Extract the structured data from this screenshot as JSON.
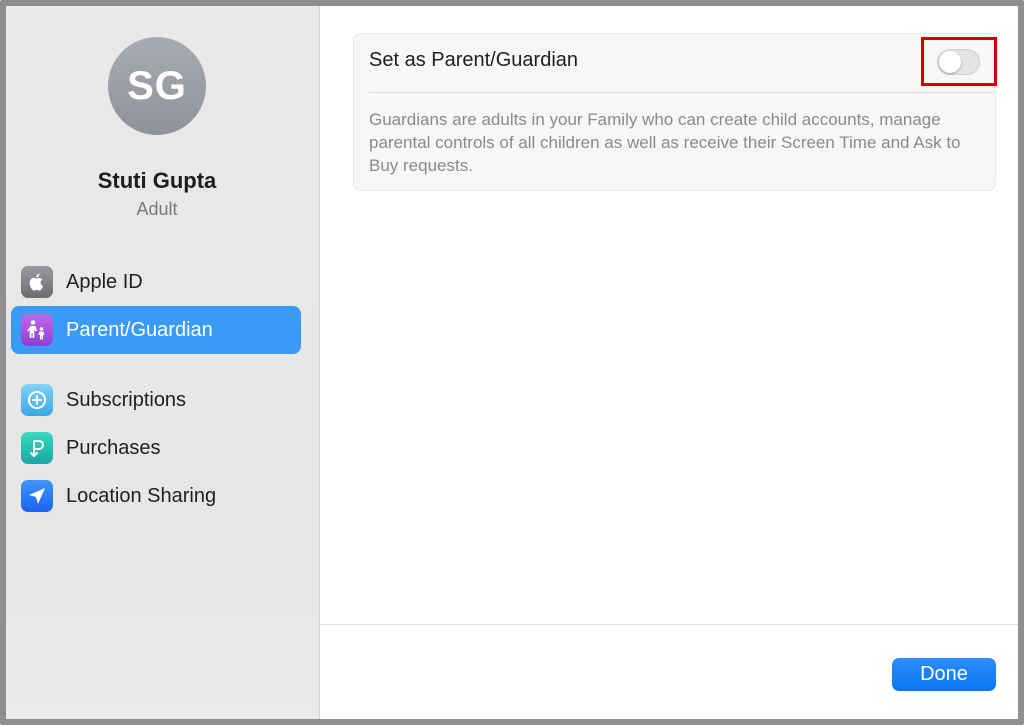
{
  "sidebar": {
    "avatar_initials": "SG",
    "user_name": "Stuti Gupta",
    "user_role": "Adult",
    "items": [
      {
        "label": "Apple ID",
        "icon": "apple-icon",
        "selected": false
      },
      {
        "label": "Parent/Guardian",
        "icon": "guardian-icon",
        "selected": true
      },
      {
        "label": "Subscriptions",
        "icon": "subscriptions-icon",
        "selected": false
      },
      {
        "label": "Purchases",
        "icon": "purchases-icon",
        "selected": false
      },
      {
        "label": "Location Sharing",
        "icon": "location-arrow-icon",
        "selected": false
      }
    ]
  },
  "main": {
    "setting_title": "Set as Parent/Guardian",
    "toggle_on": false,
    "description": "Guardians are adults in your Family who can create child accounts, manage parental controls of all children as well as receive their Screen Time and Ask to Buy requests."
  },
  "footer": {
    "done_label": "Done"
  },
  "colors": {
    "accent": "#3a9af6",
    "highlight": "#d40000"
  }
}
